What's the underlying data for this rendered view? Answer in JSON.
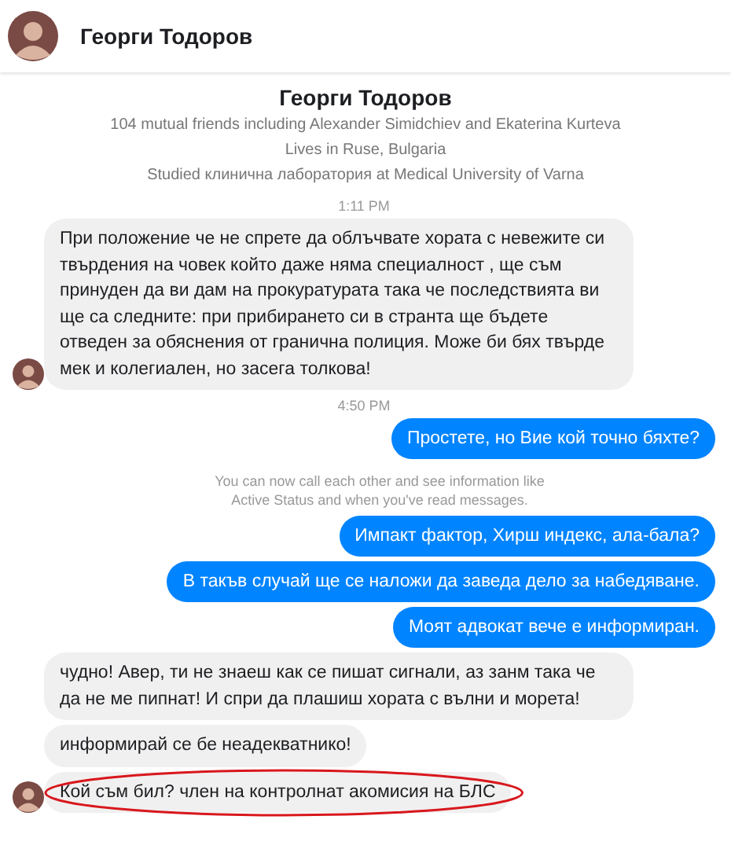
{
  "header": {
    "name": "Георги Тодоров"
  },
  "profile": {
    "name": "Георги Тодоров",
    "lines": [
      "104 mutual friends including Alexander Simidchiev and Ekaterina Kurteva",
      "Lives in Ruse, Bulgaria",
      "Studied клинична лаборатория at Medical University of Varna"
    ]
  },
  "messages": [
    {
      "kind": "timestamp",
      "text": "1:11 PM"
    },
    {
      "kind": "incoming",
      "avatar": true,
      "highlighted": false,
      "text": "При положение че не спрете да облъчвате хората с невежите си твърдения на човек който даже няма специалност , ще съм принуден да ви дам на прокуратурата така че последствията ви ще са следните: при прибирането си в странта ще бъдете отведен за обяснения от гранична полиция. Може би бях твърде мек и колегиален, но засега толкова!"
    },
    {
      "kind": "timestamp",
      "text": "4:50 PM"
    },
    {
      "kind": "outgoing",
      "avatar": false,
      "highlighted": false,
      "text": "Простете, но Вие кой точно бяхте?"
    },
    {
      "kind": "notice",
      "text": "You can now call each other and see information like Active Status and when you've read messages."
    },
    {
      "kind": "outgoing",
      "avatar": false,
      "highlighted": false,
      "text": "Импакт фактор, Хирш индекс, ала-бала?"
    },
    {
      "kind": "outgoing",
      "avatar": false,
      "highlighted": false,
      "text": "В такъв случай ще се наложи да заведа дело за набедяване."
    },
    {
      "kind": "outgoing",
      "avatar": false,
      "highlighted": false,
      "text": "Моят адвокат вече е информиран."
    },
    {
      "kind": "incoming",
      "avatar": false,
      "highlighted": false,
      "text": "чудно! Авер, ти не знаеш как се пишат сигнали, аз занм така че да не ме пипнат! И спри да плашиш хората с вълни и морета!"
    },
    {
      "kind": "incoming",
      "avatar": false,
      "highlighted": false,
      "text": "информирай се бе неадекватнико!"
    },
    {
      "kind": "incoming",
      "avatar": true,
      "highlighted": true,
      "text": "Кой съм бил? член на контролнат акомисия на БЛС"
    }
  ]
}
